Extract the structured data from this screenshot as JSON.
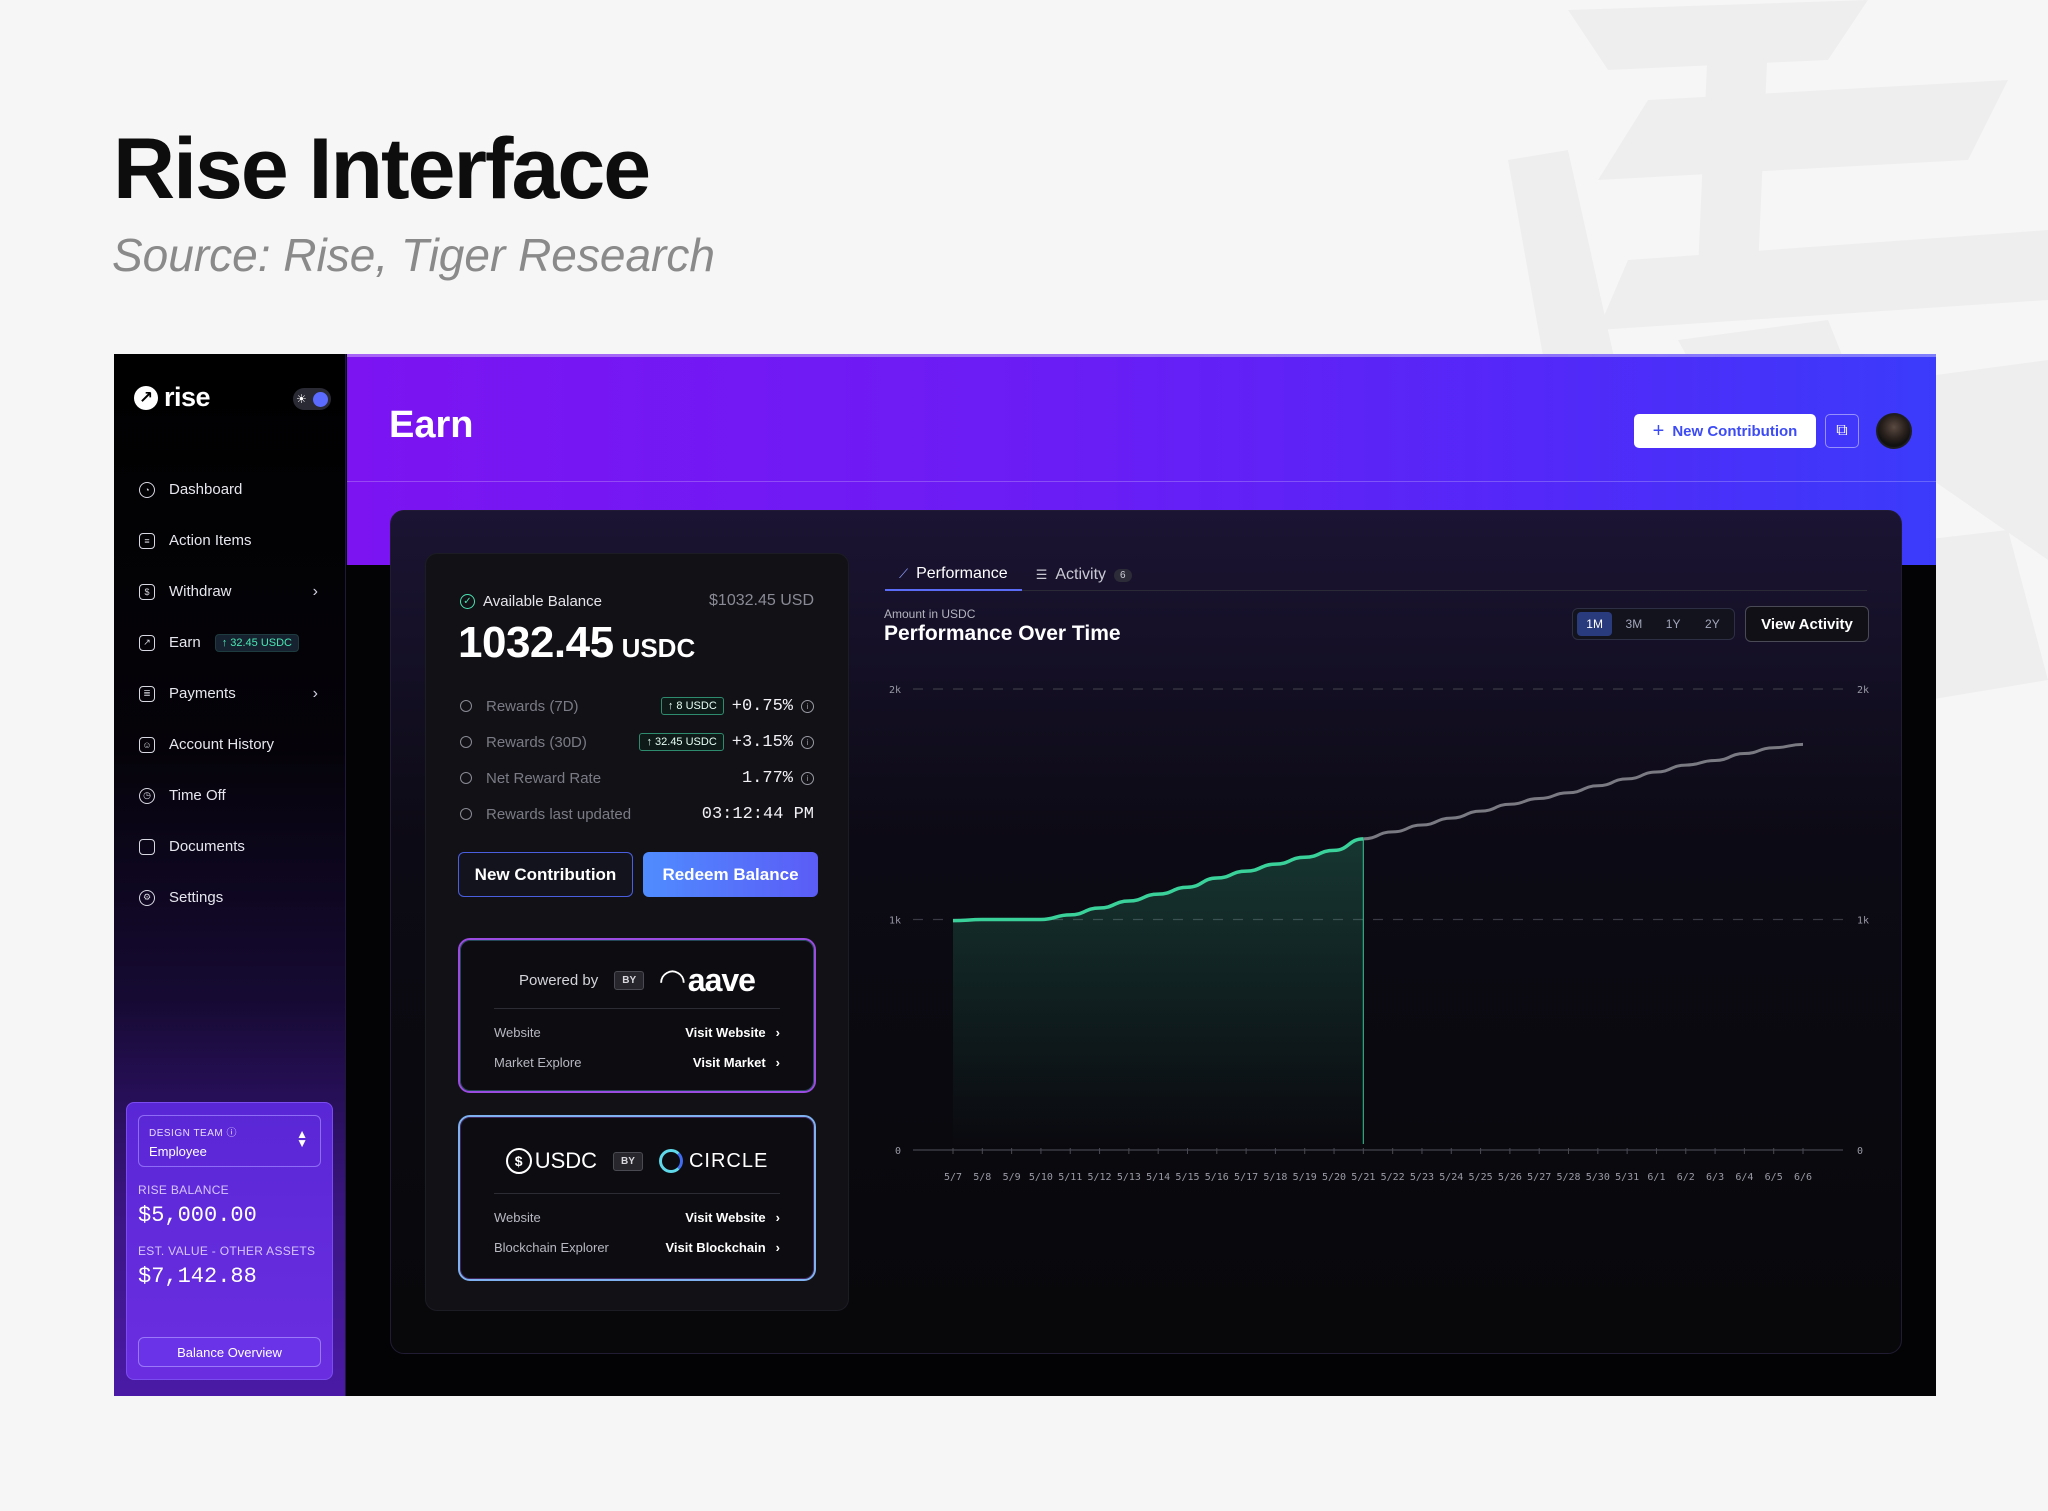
{
  "slide": {
    "title": "Rise Interface",
    "source": "Source: Rise, Tiger Research"
  },
  "sidebar": {
    "logo": "rise",
    "items": [
      {
        "label": "Dashboard",
        "icon": "dashboard-icon"
      },
      {
        "label": "Action Items",
        "icon": "checklist-icon"
      },
      {
        "label": "Withdraw",
        "icon": "withdraw-icon",
        "chevron": true
      },
      {
        "label": "Earn",
        "icon": "chart-icon",
        "badge": "↑ 32.45 USDC",
        "active": true
      },
      {
        "label": "Payments",
        "icon": "payments-icon",
        "chevron": true
      },
      {
        "label": "Account History",
        "icon": "account-history-icon"
      },
      {
        "label": "Time Off",
        "icon": "clock-icon"
      },
      {
        "label": "Documents",
        "icon": "document-icon"
      },
      {
        "label": "Settings",
        "icon": "gear-icon"
      }
    ],
    "team": {
      "team_label": "DESIGN TEAM",
      "role": "Employee",
      "rise_balance_label": "RISE BALANCE",
      "rise_balance": "$5,000.00",
      "est_value_label": "EST. VALUE - OTHER ASSETS",
      "est_value": "$7,142.88",
      "overview_button": "Balance Overview"
    }
  },
  "header": {
    "title": "Earn",
    "new_contribution": "New Contribution"
  },
  "balance": {
    "label": "Available Balance",
    "usd": "$1032.45 USD",
    "amount": "1032.45",
    "unit": "USDC",
    "stats": [
      {
        "label": "Rewards (7D)",
        "chip": "↑ 8 USDC",
        "value": "+0.75%"
      },
      {
        "label": "Rewards (30D)",
        "chip": "↑ 32.45 USDC",
        "value": "+3.15%"
      },
      {
        "label": "Net Reward Rate",
        "chip": "",
        "value": "1.77%"
      },
      {
        "label": "Rewards last updated",
        "chip": "",
        "value": "03:12:44 PM"
      }
    ],
    "btn_new": "New Contribution",
    "btn_redeem": "Redeem Balance"
  },
  "providers": {
    "aave": {
      "powered": "Powered by",
      "by": "BY",
      "logo": "aave",
      "row1_key": "Website",
      "row1_val": "Visit Website",
      "row2_key": "Market Explore",
      "row2_val": "Visit Market"
    },
    "circle": {
      "usdc": "USDC",
      "by": "BY",
      "circle": "CIRCLE",
      "row1_key": "Website",
      "row1_val": "Visit Website",
      "row2_key": "Blockchain Explorer",
      "row2_val": "Visit Blockchain"
    }
  },
  "tabs": {
    "performance": "Performance",
    "activity": "Activity",
    "activity_count": "6"
  },
  "chart_header": {
    "sub": "Amount in USDC",
    "title": "Performance Over Time",
    "ranges": [
      "1M",
      "3M",
      "1Y",
      "2Y"
    ],
    "view_activity": "View Activity"
  },
  "chart_data": {
    "type": "line",
    "title": "Performance Over Time",
    "ylabel": "Amount in USDC",
    "ylim": [
      0,
      2000
    ],
    "yticks": [
      "0",
      "1k",
      "2k"
    ],
    "categories": [
      "5/7",
      "5/8",
      "5/9",
      "5/10",
      "5/11",
      "5/12",
      "5/13",
      "5/14",
      "5/15",
      "5/16",
      "5/17",
      "5/18",
      "5/19",
      "5/20",
      "5/21",
      "5/22",
      "5/23",
      "5/24",
      "5/25",
      "5/26",
      "5/27",
      "5/28",
      "5/30",
      "5/31",
      "6/1",
      "6/2",
      "6/3",
      "6/4",
      "6/5",
      "6/6"
    ],
    "series": [
      {
        "values": [
          995,
          1000,
          1000,
          1000,
          1020,
          1050,
          1080,
          1110,
          1140,
          1180,
          1210,
          1240,
          1270,
          1300,
          1350,
          null,
          null,
          null,
          null,
          null,
          null,
          null,
          null,
          null,
          null,
          null,
          null,
          null,
          null,
          null
        ]
      },
      {
        "values": [
          null,
          null,
          null,
          null,
          null,
          null,
          null,
          null,
          null,
          null,
          null,
          null,
          null,
          null,
          1350,
          1380,
          1410,
          1440,
          1470,
          1500,
          1525,
          1550,
          1580,
          1610,
          1640,
          1670,
          1690,
          1720,
          1745,
          1760
        ]
      }
    ],
    "marker_x": "5/21",
    "grid": true,
    "colors": {
      "actual": "#3ad29a",
      "projected": "#7a7a82",
      "marker": "#3ad29a"
    }
  }
}
